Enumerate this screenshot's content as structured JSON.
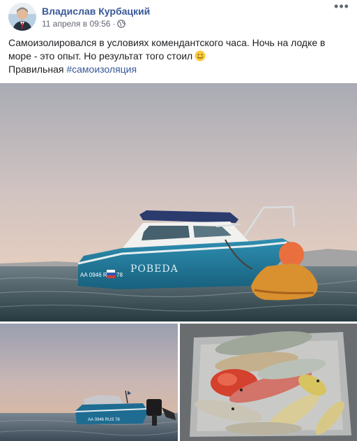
{
  "post": {
    "author_name": "Владислав Курбацкий",
    "timestamp": "11 апреля в 09:56",
    "separator": "·",
    "privacy_icon": "globe-icon",
    "more_icon": "more-dots-icon",
    "more_label": "•••",
    "text_line1": "Самоизолировался в условиях комендантского часа. Ночь на лодке в море - это опыт. Но результат того стоил",
    "emoji": "slightly-smiling-face-icon",
    "text_line2_prefix": "Правильная",
    "hashtag": "#самоизоляция",
    "link_color": "#385898"
  },
  "photos": {
    "main": {
      "subject": "boat-at-sea-dusk",
      "boat_name": "POBEDA",
      "plate": "АА 0946 RUS 78"
    },
    "left": {
      "subject": "boat-with-outboard-motor"
    },
    "right": {
      "subject": "fish-catch-in-basin"
    }
  }
}
